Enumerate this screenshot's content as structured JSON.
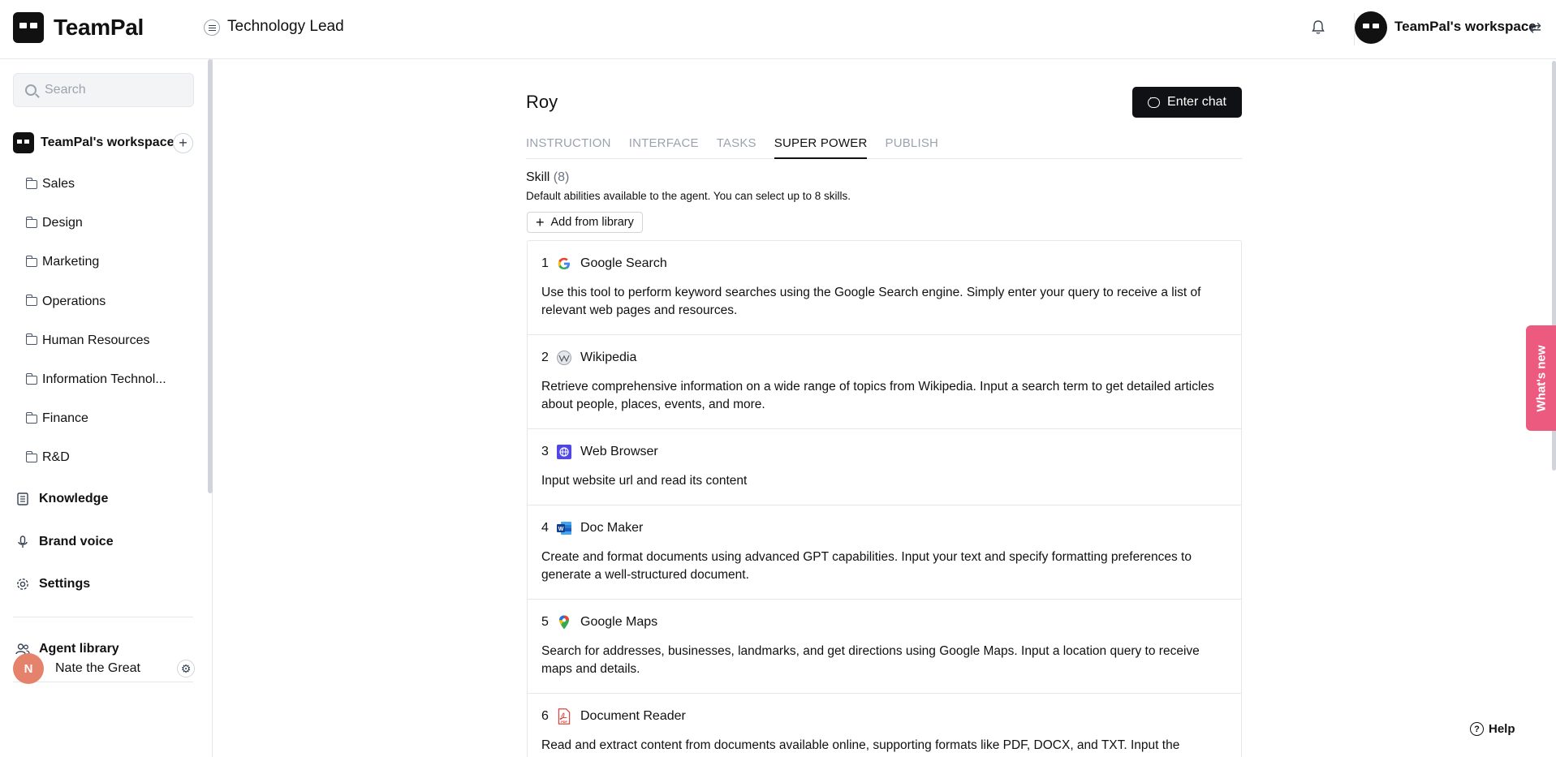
{
  "header": {
    "brand": "TeamPal",
    "page_title": "Technology Lead",
    "workspace_name": "TeamPal's workspace",
    "icons": [
      "menu-icon",
      "bell-icon",
      "switch-icon"
    ]
  },
  "sidebar": {
    "search_placeholder": "Search",
    "workspace_label": "TeamPal's workspace",
    "folders": [
      "Sales",
      "Design",
      "Marketing",
      "Operations",
      "Human Resources",
      "Information Technol...",
      "Finance",
      "R&D"
    ],
    "sections": {
      "knowledge": "Knowledge",
      "brand_voice": "Brand voice",
      "settings": "Settings",
      "agent_library": "Agent library"
    },
    "user": {
      "initial": "N",
      "name": "Nate the Great"
    }
  },
  "main": {
    "agent_name": "Roy",
    "enter_chat_label": "Enter chat",
    "tabs": [
      "INSTRUCTION",
      "INTERFACE",
      "TASKS",
      "SUPER POWER",
      "PUBLISH"
    ],
    "active_tab": "SUPER POWER",
    "skill_heading": "Skill",
    "skill_count": "(8)",
    "skill_desc": "Default abilities available to the agent. You can select up to 8 skills.",
    "add_library_label": "Add from library",
    "skills": [
      {
        "num": "1",
        "name": "Google Search",
        "icon": "google-icon",
        "desc": "Use this tool to perform keyword searches using the Google Search engine. Simply enter your query to receive a list of relevant web pages and resources."
      },
      {
        "num": "2",
        "name": "Wikipedia",
        "icon": "wikipedia-icon",
        "desc": "Retrieve comprehensive information on a wide range of topics from Wikipedia. Input a search term to get detailed articles about people, places, events, and more."
      },
      {
        "num": "3",
        "name": "Web Browser",
        "icon": "web-browser-icon",
        "desc": "Input website url and read its content"
      },
      {
        "num": "4",
        "name": "Doc Maker",
        "icon": "word-doc-icon",
        "desc": "Create and format documents using advanced GPT capabilities. Input your text and specify formatting preferences to generate a well-structured document."
      },
      {
        "num": "5",
        "name": "Google Maps",
        "icon": "map-pin-icon",
        "desc": "Search for addresses, businesses, landmarks, and get directions using Google Maps. Input a location query to receive maps and details."
      },
      {
        "num": "6",
        "name": "Document Reader",
        "icon": "pdf-icon",
        "desc": "Read and extract content from documents available online, supporting formats like PDF, DOCX, and TXT. Input the"
      }
    ]
  },
  "floating": {
    "whats_new": "What's new",
    "help": "Help"
  },
  "colors": {
    "primary_dark": "#0f1114",
    "whats_new_pink": "#ec5b7f",
    "avatar_salmon": "#e4826b",
    "border": "#e5e7eb",
    "muted_text": "#9ca3af"
  }
}
